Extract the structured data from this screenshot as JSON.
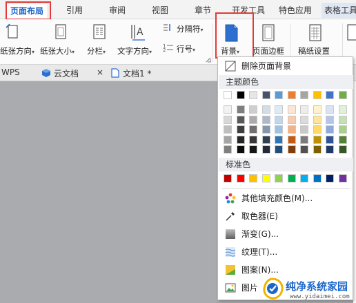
{
  "tabs": [
    {
      "label": "页面布局",
      "active": true
    },
    {
      "label": "引用"
    },
    {
      "label": "审阅"
    },
    {
      "label": "视图"
    },
    {
      "label": "章节"
    },
    {
      "label": "开发工具"
    },
    {
      "label": "特色应用"
    },
    {
      "label": "表格工具"
    }
  ],
  "ribbon": {
    "paper_direction": "纸张方向",
    "paper_size": "纸张大小",
    "columns": "分栏",
    "text_direction": "文字方向",
    "separator": "分隔符",
    "line_number": "行号",
    "background": "背景",
    "page_border": "页面边框",
    "manuscript": "稿纸设置",
    "caret": "▾"
  },
  "doc_tabs": {
    "wps": "WPS",
    "cloud": "云文档",
    "doc1": "文档1 *",
    "close": "×"
  },
  "menu": {
    "remove_bg": "删除页面背景",
    "theme_colors": "主题颜色",
    "standard_colors": "标准色",
    "more_colors": "其他填充颜色(M)...",
    "picker": "取色器(E)",
    "gradient": "渐变(G)...",
    "texture": "纹理(T)...",
    "pattern": "图案(N)...",
    "picture": "图片"
  },
  "colors": {
    "theme_top": [
      "#ffffff",
      "#000000",
      "#e7e6e6",
      "#44546a",
      "#5b9bd5",
      "#ed7d31",
      "#a5a5a5",
      "#ffc000",
      "#4472c4",
      "#70ad47"
    ],
    "theme_shades": [
      [
        "#f2f2f2",
        "#7f7f7f",
        "#d0cece",
        "#d6dce4",
        "#deebf6",
        "#fbe5d5",
        "#ededed",
        "#fff2cc",
        "#dae3f3",
        "#e2efd9"
      ],
      [
        "#d8d8d8",
        "#595959",
        "#aeabab",
        "#adb9ca",
        "#bdd7ee",
        "#f7cbac",
        "#dbdbdb",
        "#fee599",
        "#b4c6e7",
        "#c5e0b3"
      ],
      [
        "#bfbfbf",
        "#3f3f3f",
        "#757070",
        "#8496b0",
        "#9cc3e5",
        "#f4b183",
        "#c9c9c9",
        "#ffd965",
        "#8eaadb",
        "#a8d08d"
      ],
      [
        "#a5a5a5",
        "#262626",
        "#3a3838",
        "#323f4f",
        "#2e75b5",
        "#c55a11",
        "#7b7b7b",
        "#bf9000",
        "#2f5496",
        "#538135"
      ],
      [
        "#7f7f7f",
        "#0c0c0c",
        "#171616",
        "#222a35",
        "#1e4e79",
        "#833c0b",
        "#525252",
        "#7f6000",
        "#1f3864",
        "#375623"
      ]
    ],
    "standard": [
      "#c00000",
      "#ff0000",
      "#ffc000",
      "#ffff00",
      "#92d050",
      "#00b050",
      "#00b0f0",
      "#0070c0",
      "#002060",
      "#7030a0"
    ],
    "accent": "#1a64c8",
    "highlight": "#e53935"
  },
  "watermark": {
    "title": "纯净系统家园",
    "url": "www.yidaimei.com"
  }
}
